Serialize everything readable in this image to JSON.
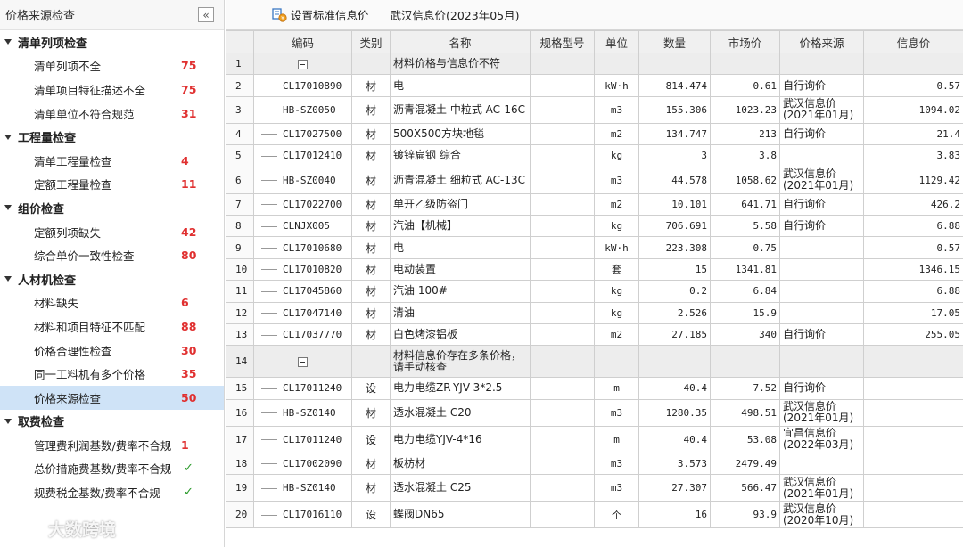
{
  "left_panel": {
    "title": "价格来源检查",
    "collapse_icon": "«",
    "groups": [
      {
        "label": "清单列项检查",
        "items": [
          {
            "label": "清单列项不全",
            "count": "75"
          },
          {
            "label": "清单项目特征描述不全",
            "count": "75"
          },
          {
            "label": "清单单位不符合规范",
            "count": "31"
          }
        ]
      },
      {
        "label": "工程量检查",
        "items": [
          {
            "label": "清单工程量检查",
            "count": "4"
          },
          {
            "label": "定额工程量检查",
            "count": "11"
          }
        ]
      },
      {
        "label": "组价检查",
        "items": [
          {
            "label": "定额列项缺失",
            "count": "42"
          },
          {
            "label": "综合单价一致性检查",
            "count": "80"
          }
        ]
      },
      {
        "label": "人材机检查",
        "items": [
          {
            "label": "材料缺失",
            "count": "6"
          },
          {
            "label": "材料和项目特征不匹配",
            "count": "88"
          },
          {
            "label": "价格合理性检查",
            "count": "30"
          },
          {
            "label": "同一工料机有多个价格",
            "count": "35"
          },
          {
            "label": "价格来源检查",
            "count": "50",
            "selected": true
          }
        ]
      },
      {
        "label": "取费检查",
        "items": [
          {
            "label": "管理费利润基数/费率不合规",
            "count": "1"
          },
          {
            "label": "总价措施费基数/费率不合规",
            "check": "✓"
          },
          {
            "label": "规费税金基数/费率不合规",
            "check": "✓"
          }
        ]
      }
    ]
  },
  "watermark": {
    "text": "大数跨境"
  },
  "toolbar": {
    "set_price_label": "设置标准信息价",
    "info_price_label": "武汉信息价(2023年05月)"
  },
  "table": {
    "headers": [
      "",
      "编码",
      "类别",
      "名称",
      "规格型号",
      "单位",
      "数量",
      "市场价",
      "价格来源",
      "信息价"
    ],
    "rows": [
      {
        "idx": "1",
        "group": true,
        "name": "材料价格与信息价不符"
      },
      {
        "idx": "2",
        "code": "CL17010890",
        "cat": "材",
        "name": "电",
        "spec": "",
        "unit": "kW·h",
        "qty": "814.474",
        "market": "0.61",
        "src": "自行询价",
        "info": "0.57"
      },
      {
        "idx": "3",
        "code": "HB-SZ0050",
        "cat": "材",
        "name": "沥青混凝土 中粒式 AC-16C",
        "spec": "",
        "unit": "m3",
        "qty": "155.306",
        "market": "1023.23",
        "src": "武汉信息价(2021年01月)",
        "info": "1094.02"
      },
      {
        "idx": "4",
        "code": "CL17027500",
        "cat": "材",
        "name": "500X500方块地毯",
        "spec": "",
        "unit": "m2",
        "qty": "134.747",
        "market": "213",
        "src": "自行询价",
        "info": "21.4"
      },
      {
        "idx": "5",
        "code": "CL17012410",
        "cat": "材",
        "name": "镀锌扁钢 综合",
        "spec": "",
        "unit": "kg",
        "qty": "3",
        "market": "3.8",
        "src": "",
        "info": "3.83"
      },
      {
        "idx": "6",
        "code": "HB-SZ0040",
        "cat": "材",
        "name": "沥青混凝土 细粒式 AC-13C",
        "spec": "",
        "unit": "m3",
        "qty": "44.578",
        "market": "1058.62",
        "src": "武汉信息价(2021年01月)",
        "info": "1129.42"
      },
      {
        "idx": "7",
        "code": "CL17022700",
        "cat": "材",
        "name": "单开乙级防盗门",
        "spec": "",
        "unit": "m2",
        "qty": "10.101",
        "market": "641.71",
        "src": "自行询价",
        "info": "426.2"
      },
      {
        "idx": "8",
        "code": "CLNJX005",
        "cat": "材",
        "name": "汽油【机械】",
        "spec": "",
        "unit": "kg",
        "qty": "706.691",
        "market": "5.58",
        "src": "自行询价",
        "info": "6.88"
      },
      {
        "idx": "9",
        "code": "CL17010680",
        "cat": "材",
        "name": "电",
        "spec": "",
        "unit": "kW·h",
        "qty": "223.308",
        "market": "0.75",
        "src": "",
        "info": "0.57"
      },
      {
        "idx": "10",
        "code": "CL17010820",
        "cat": "材",
        "name": "电动装置",
        "spec": "",
        "unit": "套",
        "qty": "15",
        "market": "1341.81",
        "src": "",
        "info": "1346.15"
      },
      {
        "idx": "11",
        "code": "CL17045860",
        "cat": "材",
        "name": "汽油 100#",
        "spec": "",
        "unit": "kg",
        "qty": "0.2",
        "market": "6.84",
        "src": "",
        "info": "6.88"
      },
      {
        "idx": "12",
        "code": "CL17047140",
        "cat": "材",
        "name": "清油",
        "spec": "",
        "unit": "kg",
        "qty": "2.526",
        "market": "15.9",
        "src": "",
        "info": "17.05"
      },
      {
        "idx": "13",
        "code": "CL17037770",
        "cat": "材",
        "name": "白色烤漆铝板",
        "spec": "",
        "unit": "m2",
        "qty": "27.185",
        "market": "340",
        "src": "自行询价",
        "info": "255.05"
      },
      {
        "idx": "14",
        "group": true,
        "name": "材料信息价存在多条价格，请手动核查"
      },
      {
        "idx": "15",
        "code": "CL17011240",
        "cat": "设",
        "name": "电力电缆ZR-YJV-3*2.5",
        "spec": "",
        "unit": "m",
        "qty": "40.4",
        "market": "7.52",
        "src": "自行询价",
        "info": ""
      },
      {
        "idx": "16",
        "code": "HB-SZ0140",
        "cat": "材",
        "name": "透水混凝土 C20",
        "spec": "",
        "unit": "m3",
        "qty": "1280.35",
        "market": "498.51",
        "src": "武汉信息价(2021年01月)",
        "info": ""
      },
      {
        "idx": "17",
        "code": "CL17011240",
        "cat": "设",
        "name": "电力电缆YJV-4*16",
        "spec": "",
        "unit": "m",
        "qty": "40.4",
        "market": "53.08",
        "src": "宜昌信息价(2022年03月)",
        "info": ""
      },
      {
        "idx": "18",
        "code": "CL17002090",
        "cat": "材",
        "name": "板枋材",
        "spec": "",
        "unit": "m3",
        "qty": "3.573",
        "market": "2479.49",
        "src": "",
        "info": ""
      },
      {
        "idx": "19",
        "code": "HB-SZ0140",
        "cat": "材",
        "name": "透水混凝土 C25",
        "spec": "",
        "unit": "m3",
        "qty": "27.307",
        "market": "566.47",
        "src": "武汉信息价(2021年01月)",
        "info": ""
      },
      {
        "idx": "20",
        "code": "CL17016110",
        "cat": "设",
        "name": "蝶阀DN65",
        "spec": "",
        "unit": "个",
        "qty": "16",
        "market": "93.9",
        "src": "武汉信息价(2020年10月)",
        "info": ""
      }
    ]
  }
}
